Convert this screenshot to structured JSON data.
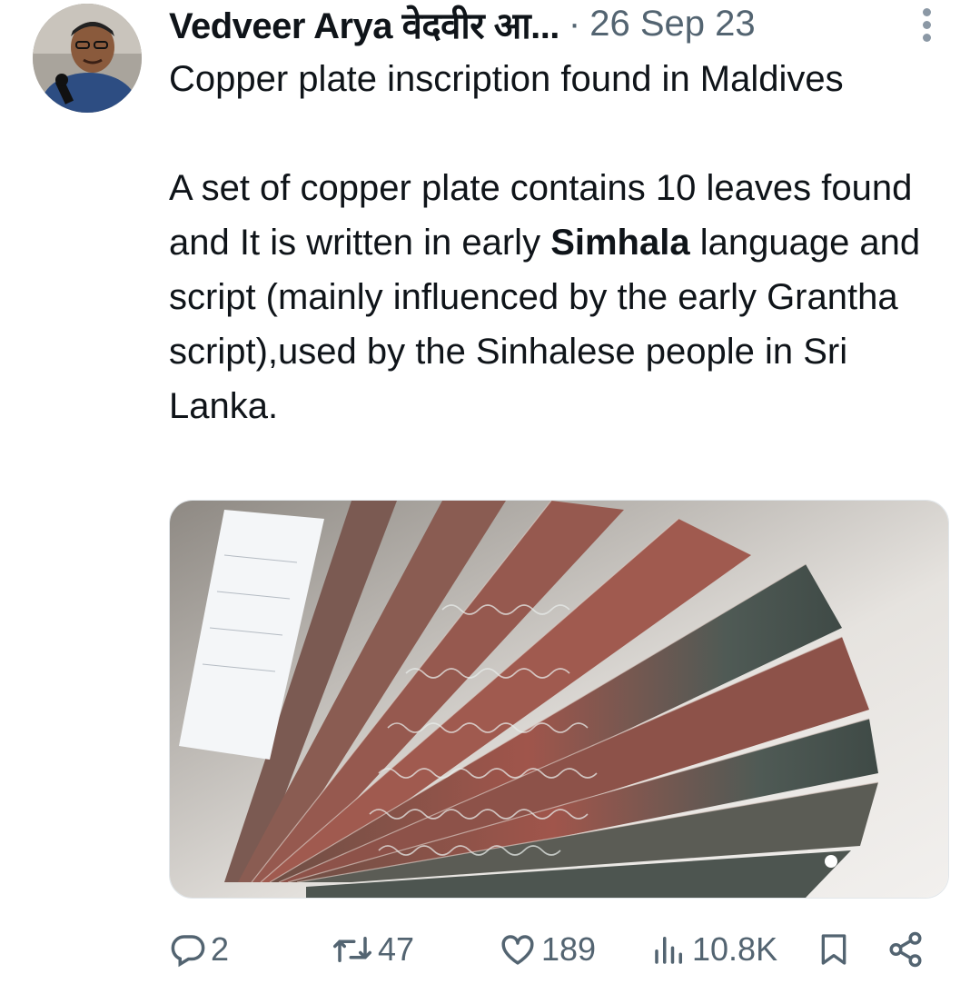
{
  "author": {
    "display_name": "Vedveer Arya वेदवीर आ...",
    "separator": "·",
    "date": "26 Sep 23"
  },
  "tweet": {
    "line1": "Copper plate inscription found in Maldives",
    "para2_before": "A set of copper plate contains 10 leaves found and It is written in early ",
    "para2_bold": "Simhala",
    "para2_after": " language and script (mainly influenced by the early Grantha script),used by the Sinhalese people in Sri Lanka."
  },
  "actions": {
    "replies": "2",
    "reposts": "47",
    "likes": "189",
    "views": "10.8K"
  },
  "icons": {
    "more": "more-vertical-icon",
    "reply": "reply-icon",
    "repost": "repost-icon",
    "like": "heart-icon",
    "views": "views-icon",
    "bookmark": "bookmark-icon",
    "share": "share-icon"
  },
  "colors": {
    "text": "#0f1419",
    "secondary": "#536471",
    "more_dots": "#8b98a5"
  }
}
